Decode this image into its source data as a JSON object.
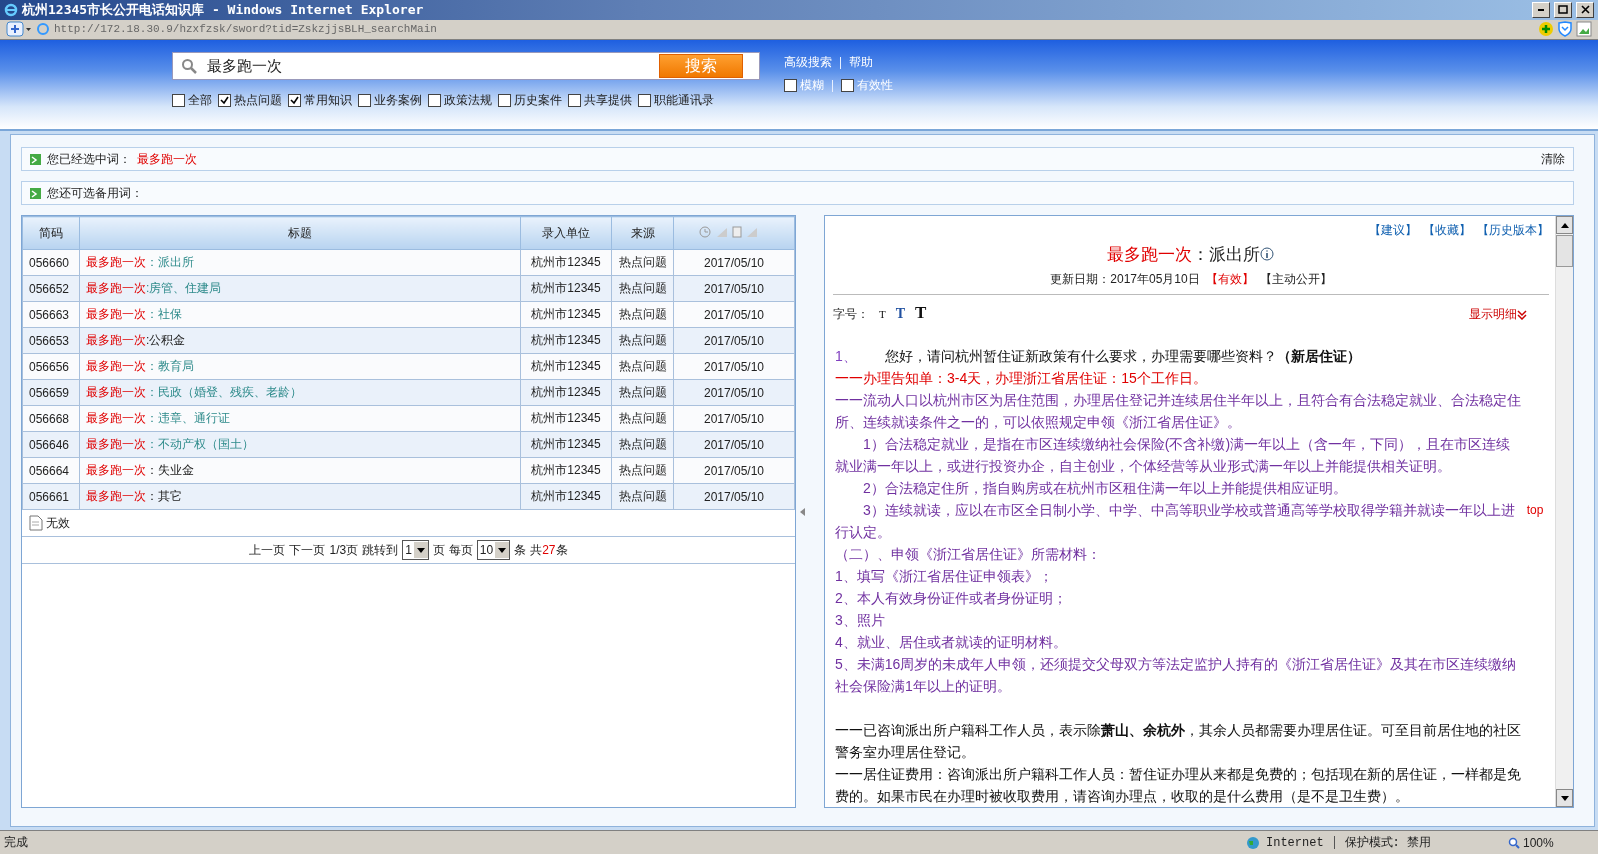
{
  "window": {
    "title": "杭州12345市长公开电话知识库 - Windows Internet Explorer",
    "url": "http://172.18.30.9/hzxfzsk/sword?tid=ZskzjjsBLH_searchMain"
  },
  "search": {
    "value": "最多跑一次",
    "button": "搜索",
    "links": [
      "高级搜索",
      "帮助"
    ],
    "categories": [
      {
        "label": "全部",
        "checked": false
      },
      {
        "label": "热点问题",
        "checked": true
      },
      {
        "label": "常用知识",
        "checked": true
      },
      {
        "label": "业务案例",
        "checked": false
      },
      {
        "label": "政策法规",
        "checked": false
      },
      {
        "label": "历史案件",
        "checked": false
      },
      {
        "label": "共享提供",
        "checked": false
      },
      {
        "label": "职能通讯录",
        "checked": false
      }
    ],
    "options": [
      {
        "label": "模糊",
        "checked": false
      },
      {
        "label": "有效性",
        "checked": false
      }
    ]
  },
  "selected_terms": {
    "label": "您已经选中词：",
    "term": "最多跑一次",
    "clear": "清除"
  },
  "alternate_terms": {
    "label": "您还可选备用词："
  },
  "table": {
    "columns": [
      "简码",
      "标题",
      "录入单位",
      "来源"
    ],
    "rows": [
      {
        "code": "056660",
        "prefix": "最多跑一次",
        "suffix": "：派出所",
        "linked": true,
        "unit": "杭州市12345",
        "source": "热点问题",
        "date": "2017/05/10"
      },
      {
        "code": "056652",
        "prefix": "最多跑一次",
        "suffix": ":房管、住建局",
        "linked": true,
        "unit": "杭州市12345",
        "source": "热点问题",
        "date": "2017/05/10"
      },
      {
        "code": "056663",
        "prefix": "最多跑一次",
        "suffix": "：社保",
        "linked": true,
        "unit": "杭州市12345",
        "source": "热点问题",
        "date": "2017/05/10"
      },
      {
        "code": "056653",
        "prefix": "最多跑一次",
        "suffix": ":公积金",
        "linked": false,
        "unit": "杭州市12345",
        "source": "热点问题",
        "date": "2017/05/10"
      },
      {
        "code": "056656",
        "prefix": "最多跑一次",
        "suffix": "：教育局",
        "linked": true,
        "unit": "杭州市12345",
        "source": "热点问题",
        "date": "2017/05/10"
      },
      {
        "code": "056659",
        "prefix": "最多跑一次",
        "suffix": "：民政（婚登、残疾、老龄）",
        "linked": true,
        "unit": "杭州市12345",
        "source": "热点问题",
        "date": "2017/05/10"
      },
      {
        "code": "056668",
        "prefix": "最多跑一次",
        "suffix": "：违章、通行证",
        "linked": true,
        "unit": "杭州市12345",
        "source": "热点问题",
        "date": "2017/05/10"
      },
      {
        "code": "056646",
        "prefix": "最多跑一次",
        "suffix": "：不动产权（国土）",
        "linked": true,
        "unit": "杭州市12345",
        "source": "热点问题",
        "date": "2017/05/10"
      },
      {
        "code": "056664",
        "prefix": "最多跑一次",
        "suffix": "：失业金",
        "linked": false,
        "unit": "杭州市12345",
        "source": "热点问题",
        "date": "2017/05/10"
      },
      {
        "code": "056661",
        "prefix": "最多跑一次",
        "suffix": "：其它",
        "linked": false,
        "unit": "杭州市12345",
        "source": "热点问题",
        "date": "2017/05/10"
      }
    ],
    "invalid_label": "无效",
    "pager": {
      "prev": "上一页",
      "next": "下一页",
      "pages": "1/3页",
      "goto": "跳转到",
      "page": "1",
      "page_unit": "页",
      "per_page_label": "每页",
      "per_page": "10",
      "per_page_unit": "条",
      "total_prefix": "共",
      "total": "27",
      "total_unit": "条"
    }
  },
  "detail": {
    "links": [
      "【建议】",
      "【收藏】",
      "【历史版本】"
    ],
    "title_prefix": "最多跑一次",
    "title_suffix": "：派出所",
    "date": "更新日期：2017年05月10日",
    "status": "【有效】",
    "scope": "【主动公开】",
    "font_size_label": "字号：",
    "font_sizes": [
      "T",
      "T",
      "T"
    ],
    "show_detail": "显示明细",
    "top_link": "top",
    "paragraphs": [
      {
        "kind": "question",
        "number": "1、",
        "text": "您好，请问杭州暂住证新政策有什么要求，办理需要哪些资料？**（新居住证）**"
      },
      {
        "kind": "notice",
        "text": "一一办理告知单：3-4天，办理浙江省居住证：15个工作日。"
      },
      {
        "kind": "info",
        "text": "一一流动人口以杭州市区为居住范围，办理居住登记并连续居住半年以上，且符合有合法稳定就业、合法稳定住所、连续就读条件之一的，可以依照规定申领《浙江省居住证》。"
      },
      {
        "kind": "info-indent",
        "text": "1）合法稳定就业，是指在市区连续缴纳社会保险(不含补缴)满一年以上（含一年，下同），且在市区连续就业满一年以上，或进行投资办企，自主创业，个体经营等从业形式满一年以上并能提供相关证明。"
      },
      {
        "kind": "info-indent",
        "text": "2）合法稳定住所，指自购房或在杭州市区租住满一年以上并能提供相应证明。"
      },
      {
        "kind": "info-indent",
        "text": "3）连续就读，应以在市区全日制小学、中学、中高等职业学校或普通高等学校取得学籍并就读一年以上进行认定。"
      },
      {
        "kind": "info",
        "text": "（二）、申领《浙江省居住证》所需材料："
      },
      {
        "kind": "info",
        "text": "1、填写《浙江省居住证申领表》；"
      },
      {
        "kind": "info",
        "text": "2、本人有效身份证件或者身份证明；"
      },
      {
        "kind": "info",
        "text": "3、照片"
      },
      {
        "kind": "info",
        "text": "4、就业、居住或者就读的证明材料。"
      },
      {
        "kind": "info",
        "text": " 5、未满16周岁的未成年人申领，还须提交父母双方等法定监护人持有的《浙江省居住证》及其在市区连续缴纳社会保险满1年以上的证明。"
      },
      {
        "kind": "gap"
      },
      {
        "kind": "plain",
        "text": "一一已咨询派出所户籍科工作人员，表示除**萧山、余杭外**，其余人员都需要办理居住证。可至目前居住地的社区警务室办理居住登记。"
      },
      {
        "kind": "plain",
        "text": "一一居住证费用：咨询派出所户籍科工作人员：暂住证办理从来都是免费的；包括现在新的居住证，一样都是免费的。如果市民在办理时被收取费用，请咨询办理点，收取的是什么费用（是不是卫生费）。"
      }
    ]
  },
  "status_bar": {
    "text": "完成",
    "zone": "Internet",
    "protected_mode": "保护模式: 禁用",
    "zoom": "100%"
  }
}
